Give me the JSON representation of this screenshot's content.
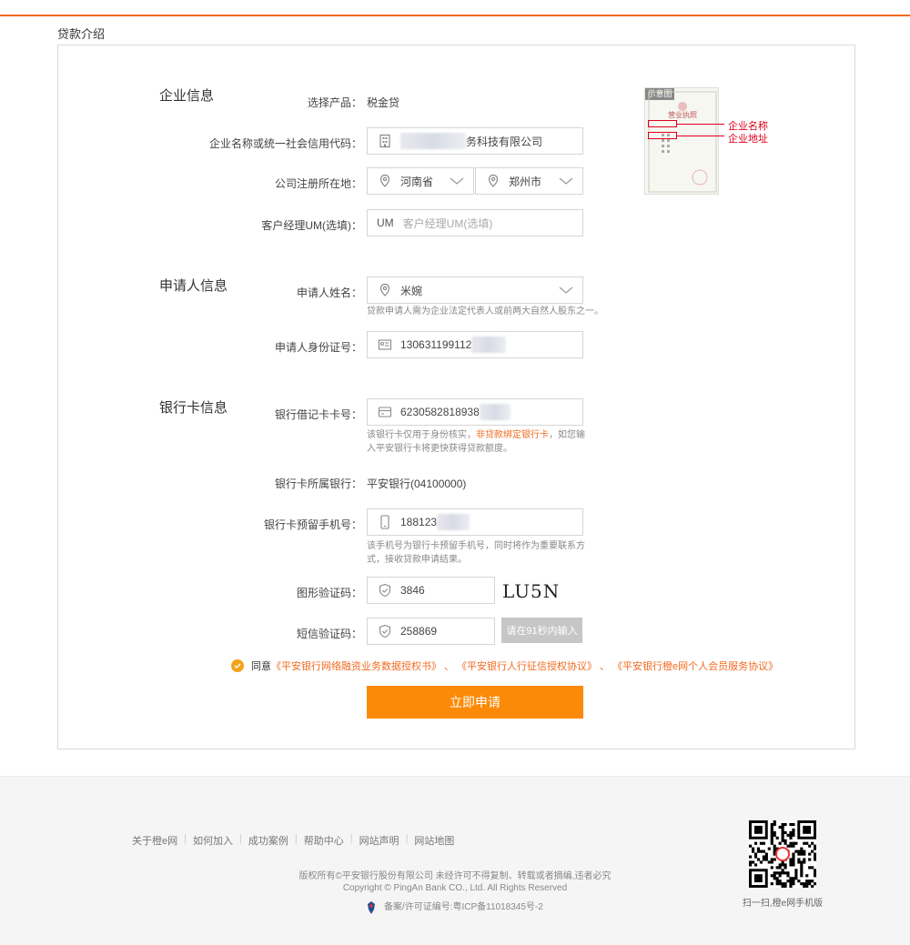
{
  "page": {
    "title": "贷款介绍",
    "accent": "#f26b21",
    "button_color": "#fb8a08"
  },
  "sections": {
    "company": "企业信息",
    "applicant": "申请人信息",
    "bank": "银行卡信息"
  },
  "company": {
    "product_label": "选择产品：",
    "product_value": "税金贷",
    "name_label": "企业名称或统一社会信用代码：",
    "name_value": "务科技有限公司",
    "region_label": "公司注册所在地：",
    "province": "河南省",
    "city": "郑州市",
    "um_label": "客户经理UM(选填)：",
    "um_prefix": "UM",
    "um_placeholder": "客户经理UM(选填)"
  },
  "sample": {
    "tag": "示意图",
    "license_title": "营业执照",
    "annot_name": "企业名称",
    "annot_address": "企业地址"
  },
  "applicant": {
    "name_label": "申请人姓名：",
    "name_value": "米婉",
    "name_hint": "贷款申请人需为企业法定代表人或前两大自然人股东之一。",
    "id_label": "申请人身份证号：",
    "id_value": "130631199112"
  },
  "bank": {
    "card_label": "银行借记卡卡号：",
    "card_value": "6230582818938",
    "card_hint_pre": "该银行卡仅用于身份核实，",
    "card_hint_highlight": "非贷款绑定银行卡",
    "card_hint_post": "，如您输入平安银行卡将更快获得贷款额度。",
    "bank_label": "银行卡所属银行：",
    "bank_value": "平安银行(04100000)",
    "phone_label": "银行卡预留手机号：",
    "phone_value": "188123",
    "phone_hint": "该手机号为银行卡预留手机号，同时将作为重要联系方式，接收贷款申请结果。",
    "captcha_label": "图形验证码：",
    "captcha_value": "3846",
    "captcha_image_text": "LU5N",
    "sms_label": "短信验证码：",
    "sms_value": "258869",
    "sms_button": "请在91秒内输入"
  },
  "agreement": {
    "prefix": "同意",
    "link1": "《平安银行网络融资业务数据授权书》",
    "sep1": "、",
    "link2": "《平安银行人行征信授权协议》",
    "sep2": "、",
    "link3": "《平安银行橙e网个人会员服务协议》"
  },
  "submit_label": "立即申请",
  "footer": {
    "links": [
      "关于橙e网",
      "如何加入",
      "成功案例",
      "帮助中心",
      "网站声明",
      "网站地图"
    ],
    "copyright_cn": "版权所有©平安银行股份有限公司 未经许可不得复制、转载或者摘编,违者必究",
    "copyright_en": "Copyright © PingAn Bank CO., Ltd. All Rights Reserved",
    "icp": "备案/许可证编号:粤ICP备11018345号-2",
    "qr_caption": "扫一扫,橙e网手机版"
  }
}
